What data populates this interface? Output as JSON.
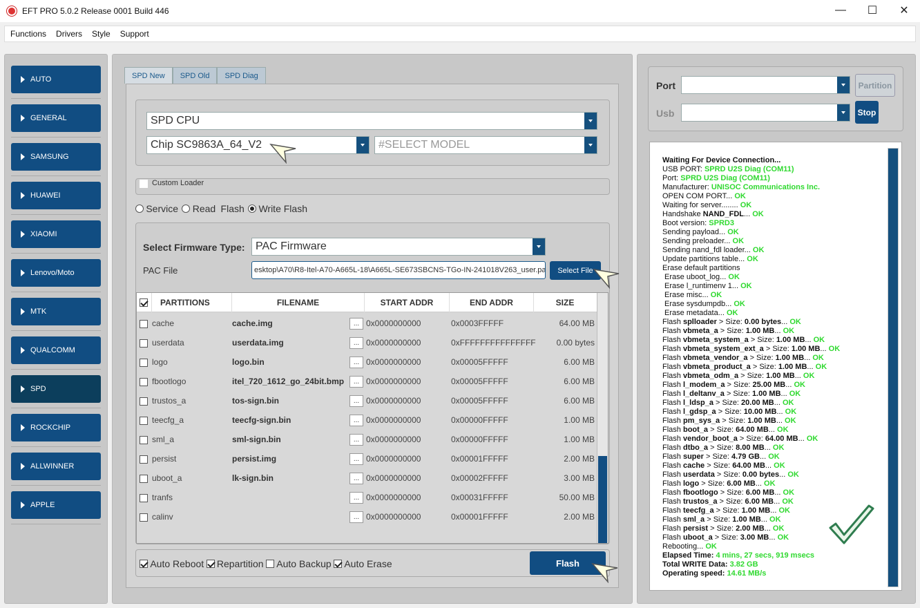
{
  "window": {
    "title": "EFT PRO 5.0.2 Release 0001 Build 446"
  },
  "menu": [
    "Functions",
    "Drivers",
    "Style",
    "Support"
  ],
  "sidebar": [
    {
      "label": "AUTO",
      "active": false
    },
    {
      "label": "GENERAL",
      "active": false
    },
    {
      "label": "SAMSUNG",
      "active": false
    },
    {
      "label": "HUAWEI",
      "active": false
    },
    {
      "label": "XIAOMI",
      "active": false
    },
    {
      "label": "Lenovo/Moto",
      "active": false
    },
    {
      "label": "MTK",
      "active": false
    },
    {
      "label": "QUALCOMM",
      "active": false
    },
    {
      "label": "SPD",
      "active": true
    },
    {
      "label": "ROCKCHIP",
      "active": false
    },
    {
      "label": "ALLWINNER",
      "active": false
    },
    {
      "label": "APPLE",
      "active": false
    }
  ],
  "tabs": [
    "SPD New",
    "SPD Old",
    "SPD Diag"
  ],
  "cpu_select": {
    "value": "SPD CPU"
  },
  "chip_select": {
    "value": "Chip SC9863A_64_V2"
  },
  "model_select": {
    "value": "#SELECT MODEL"
  },
  "custom_loader": {
    "label": "Custom Loader",
    "checked": false
  },
  "mode_options": {
    "service": "Service",
    "read": "Read",
    "flash": "Flash",
    "write_flash": "Write Flash",
    "selected": "write_flash"
  },
  "firmware": {
    "type_label": "Select Firmware Type:",
    "type_value": "PAC Firmware",
    "pac_label": "PAC File",
    "pac_value": "esktop\\A70\\R8-Itel-A70-A665L-18\\A665L-SE673SBCNS-TGo-IN-241018V263_user.pac",
    "select_button": "Select File"
  },
  "table": {
    "headers": [
      "PARTITIONS",
      "FILENAME",
      "START ADDR",
      "END ADDR",
      "SIZE"
    ],
    "dots": "...",
    "rows": [
      {
        "name": "cache",
        "file": "cache.img",
        "start": "0x0000000000",
        "end": "0x0003FFFFF",
        "size": "64.00 MB"
      },
      {
        "name": "userdata",
        "file": "userdata.img",
        "start": "0x0000000000",
        "end": "0xFFFFFFFFFFFFFFF",
        "size": "0.00 bytes"
      },
      {
        "name": "logo",
        "file": "logo.bin",
        "start": "0x0000000000",
        "end": "0x00005FFFFF",
        "size": "6.00 MB"
      },
      {
        "name": "fbootlogo",
        "file": "itel_720_1612_go_24bit.bmp",
        "start": "0x0000000000",
        "end": "0x00005FFFFF",
        "size": "6.00 MB"
      },
      {
        "name": "trustos_a",
        "file": "tos-sign.bin",
        "start": "0x0000000000",
        "end": "0x00005FFFFF",
        "size": "6.00 MB"
      },
      {
        "name": "teecfg_a",
        "file": "teecfg-sign.bin",
        "start": "0x0000000000",
        "end": "0x00000FFFFF",
        "size": "1.00 MB"
      },
      {
        "name": "sml_a",
        "file": "sml-sign.bin",
        "start": "0x0000000000",
        "end": "0x00000FFFFF",
        "size": "1.00 MB"
      },
      {
        "name": "persist",
        "file": "persist.img",
        "start": "0x0000000000",
        "end": "0x00001FFFFF",
        "size": "2.00 MB"
      },
      {
        "name": "uboot_a",
        "file": "lk-sign.bin",
        "start": "0x0000000000",
        "end": "0x00002FFFFF",
        "size": "3.00 MB"
      },
      {
        "name": "tranfs",
        "file": "",
        "start": "0x0000000000",
        "end": "0x00031FFFFF",
        "size": "50.00 MB"
      },
      {
        "name": "calinv",
        "file": "",
        "start": "0x0000000000",
        "end": "0x00001FFFFF",
        "size": "2.00 MB"
      }
    ]
  },
  "bottom_options": {
    "auto_reboot": "Auto Reboot",
    "repartition": "Repartition",
    "auto_backup": "Auto Backup",
    "auto_erase": "Auto Erase"
  },
  "flash_button": "Flash",
  "port": {
    "label": "Port",
    "usb_label": "Usb",
    "partition_button": "Partition",
    "stop_button": "Stop"
  },
  "log": [
    [
      [
        "b",
        "Waiting For Device Connection..."
      ]
    ],
    [
      [
        "t",
        "USB PORT: "
      ],
      [
        "g",
        "SPRD U2S Diag (COM11)"
      ]
    ],
    [
      [
        "t",
        "Port: "
      ],
      [
        "g",
        "SPRD U2S Diag (COM11)"
      ]
    ],
    [
      [
        "t",
        "Manufacturer: "
      ],
      [
        "g",
        "UNISOC Communications Inc."
      ]
    ],
    [
      [
        "t",
        "OPEN COM PORT... "
      ],
      [
        "g",
        "OK"
      ]
    ],
    [
      [
        "t",
        "Waiting for server........ "
      ],
      [
        "g",
        "OK"
      ]
    ],
    [
      [
        "t",
        "Handshake "
      ],
      [
        "b",
        "NAND_FDL"
      ],
      [
        "t",
        "... "
      ],
      [
        "g",
        "OK"
      ]
    ],
    [
      [
        "t",
        "Boot version: "
      ],
      [
        "g",
        "SPRD3"
      ]
    ],
    [
      [
        "t",
        "Sending payload... "
      ],
      [
        "g",
        "OK"
      ]
    ],
    [
      [
        "t",
        "Sending preloader... "
      ],
      [
        "g",
        "OK"
      ]
    ],
    [
      [
        "t",
        "Sending nand_fdl loader... "
      ],
      [
        "g",
        "OK"
      ]
    ],
    [
      [
        "t",
        "Update partitions table... "
      ],
      [
        "g",
        "OK"
      ]
    ],
    [
      [
        "t",
        "Erase default partitions"
      ]
    ],
    [
      [
        "t",
        " Erase uboot_log... "
      ],
      [
        "g",
        "OK"
      ]
    ],
    [
      [
        "t",
        " Erase l_runtimenv 1... "
      ],
      [
        "g",
        "OK"
      ]
    ],
    [
      [
        "t",
        " Erase misc... "
      ],
      [
        "g",
        "OK"
      ]
    ],
    [
      [
        "t",
        " Erase sysdumpdb... "
      ],
      [
        "g",
        "OK"
      ]
    ],
    [
      [
        "t",
        " Erase metadata... "
      ],
      [
        "g",
        "OK"
      ]
    ],
    [
      [
        "t",
        "Flash "
      ],
      [
        "b",
        "splloader"
      ],
      [
        "t",
        " > Size: "
      ],
      [
        "b",
        "0.00 bytes"
      ],
      [
        "t",
        "... "
      ],
      [
        "g",
        "OK"
      ]
    ],
    [
      [
        "t",
        "Flash "
      ],
      [
        "b",
        "vbmeta_a"
      ],
      [
        "t",
        " > Size: "
      ],
      [
        "b",
        "1.00 MB"
      ],
      [
        "t",
        "... "
      ],
      [
        "g",
        "OK"
      ]
    ],
    [
      [
        "t",
        "Flash "
      ],
      [
        "b",
        "vbmeta_system_a"
      ],
      [
        "t",
        " > Size: "
      ],
      [
        "b",
        "1.00 MB"
      ],
      [
        "t",
        "... "
      ],
      [
        "g",
        "OK"
      ]
    ],
    [
      [
        "t",
        "Flash "
      ],
      [
        "b",
        "vbmeta_system_ext_a"
      ],
      [
        "t",
        " > Size: "
      ],
      [
        "b",
        "1.00 MB"
      ],
      [
        "t",
        "... "
      ],
      [
        "g",
        "OK"
      ]
    ],
    [
      [
        "t",
        "Flash "
      ],
      [
        "b",
        "vbmeta_vendor_a"
      ],
      [
        "t",
        " > Size: "
      ],
      [
        "b",
        "1.00 MB"
      ],
      [
        "t",
        "... "
      ],
      [
        "g",
        "OK"
      ]
    ],
    [
      [
        "t",
        "Flash "
      ],
      [
        "b",
        "vbmeta_product_a"
      ],
      [
        "t",
        " > Size: "
      ],
      [
        "b",
        "1.00 MB"
      ],
      [
        "t",
        "... "
      ],
      [
        "g",
        "OK"
      ]
    ],
    [
      [
        "t",
        "Flash "
      ],
      [
        "b",
        "vbmeta_odm_a"
      ],
      [
        "t",
        " > Size: "
      ],
      [
        "b",
        "1.00 MB"
      ],
      [
        "t",
        "... "
      ],
      [
        "g",
        "OK"
      ]
    ],
    [
      [
        "t",
        "Flash "
      ],
      [
        "b",
        "l_modem_a"
      ],
      [
        "t",
        " > Size: "
      ],
      [
        "b",
        "25.00 MB"
      ],
      [
        "t",
        "... "
      ],
      [
        "g",
        "OK"
      ]
    ],
    [
      [
        "t",
        "Flash "
      ],
      [
        "b",
        "l_deltanv_a"
      ],
      [
        "t",
        " > Size: "
      ],
      [
        "b",
        "1.00 MB"
      ],
      [
        "t",
        "... "
      ],
      [
        "g",
        "OK"
      ]
    ],
    [
      [
        "t",
        "Flash "
      ],
      [
        "b",
        "l_ldsp_a"
      ],
      [
        "t",
        " > Size: "
      ],
      [
        "b",
        "20.00 MB"
      ],
      [
        "t",
        "... "
      ],
      [
        "g",
        "OK"
      ]
    ],
    [
      [
        "t",
        "Flash "
      ],
      [
        "b",
        "l_gdsp_a"
      ],
      [
        "t",
        " > Size: "
      ],
      [
        "b",
        "10.00 MB"
      ],
      [
        "t",
        "... "
      ],
      [
        "g",
        "OK"
      ]
    ],
    [
      [
        "t",
        "Flash "
      ],
      [
        "b",
        "pm_sys_a"
      ],
      [
        "t",
        " > Size: "
      ],
      [
        "b",
        "1.00 MB"
      ],
      [
        "t",
        "... "
      ],
      [
        "g",
        "OK"
      ]
    ],
    [
      [
        "t",
        "Flash "
      ],
      [
        "b",
        "boot_a"
      ],
      [
        "t",
        " > Size: "
      ],
      [
        "b",
        "64.00 MB"
      ],
      [
        "t",
        "... "
      ],
      [
        "g",
        "OK"
      ]
    ],
    [
      [
        "t",
        "Flash "
      ],
      [
        "b",
        "vendor_boot_a"
      ],
      [
        "t",
        " > Size: "
      ],
      [
        "b",
        "64.00 MB"
      ],
      [
        "t",
        "... "
      ],
      [
        "g",
        "OK"
      ]
    ],
    [
      [
        "t",
        "Flash "
      ],
      [
        "b",
        "dtbo_a"
      ],
      [
        "t",
        " > Size: "
      ],
      [
        "b",
        "8.00 MB"
      ],
      [
        "t",
        "... "
      ],
      [
        "g",
        "OK"
      ]
    ],
    [
      [
        "t",
        "Flash "
      ],
      [
        "b",
        "super"
      ],
      [
        "t",
        " > Size: "
      ],
      [
        "b",
        "4.79 GB"
      ],
      [
        "t",
        "... "
      ],
      [
        "g",
        "OK"
      ]
    ],
    [
      [
        "t",
        "Flash "
      ],
      [
        "b",
        "cache"
      ],
      [
        "t",
        " > Size: "
      ],
      [
        "b",
        "64.00 MB"
      ],
      [
        "t",
        "... "
      ],
      [
        "g",
        "OK"
      ]
    ],
    [
      [
        "t",
        "Flash "
      ],
      [
        "b",
        "userdata"
      ],
      [
        "t",
        " > Size: "
      ],
      [
        "b",
        "0.00 bytes"
      ],
      [
        "t",
        "... "
      ],
      [
        "g",
        "OK"
      ]
    ],
    [
      [
        "t",
        "Flash "
      ],
      [
        "b",
        "logo"
      ],
      [
        "t",
        " > Size: "
      ],
      [
        "b",
        "6.00 MB"
      ],
      [
        "t",
        "... "
      ],
      [
        "g",
        "OK"
      ]
    ],
    [
      [
        "t",
        "Flash "
      ],
      [
        "b",
        "fbootlogo"
      ],
      [
        "t",
        " > Size: "
      ],
      [
        "b",
        "6.00 MB"
      ],
      [
        "t",
        "... "
      ],
      [
        "g",
        "OK"
      ]
    ],
    [
      [
        "t",
        "Flash "
      ],
      [
        "b",
        "trustos_a"
      ],
      [
        "t",
        " > Size: "
      ],
      [
        "b",
        "6.00 MB"
      ],
      [
        "t",
        "... "
      ],
      [
        "g",
        "OK"
      ]
    ],
    [
      [
        "t",
        "Flash "
      ],
      [
        "b",
        "teecfg_a"
      ],
      [
        "t",
        " > Size: "
      ],
      [
        "b",
        "1.00 MB"
      ],
      [
        "t",
        "... "
      ],
      [
        "g",
        "OK"
      ]
    ],
    [
      [
        "t",
        "Flash "
      ],
      [
        "b",
        "sml_a"
      ],
      [
        "t",
        " > Size: "
      ],
      [
        "b",
        "1.00 MB"
      ],
      [
        "t",
        "... "
      ],
      [
        "g",
        "OK"
      ]
    ],
    [
      [
        "t",
        "Flash "
      ],
      [
        "b",
        "persist"
      ],
      [
        "t",
        " > Size: "
      ],
      [
        "b",
        "2.00 MB"
      ],
      [
        "t",
        "... "
      ],
      [
        "g",
        "OK"
      ]
    ],
    [
      [
        "t",
        "Flash "
      ],
      [
        "b",
        "uboot_a"
      ],
      [
        "t",
        " > Size: "
      ],
      [
        "b",
        "3.00 MB"
      ],
      [
        "t",
        "... "
      ],
      [
        "g",
        "OK"
      ]
    ],
    [
      [
        "t",
        "Rebooting... "
      ],
      [
        "g",
        "OK"
      ]
    ],
    [
      [
        "b",
        "Elapsed Time: "
      ],
      [
        "g",
        "4 mins, 27 secs, 919 msecs"
      ]
    ],
    [
      [
        "b",
        "Total WRITE Data: "
      ],
      [
        "g",
        "3.82 GB"
      ]
    ],
    [
      [
        "b",
        "Operating speed: "
      ],
      [
        "g",
        "14.61 MB/s"
      ]
    ]
  ],
  "icons": {
    "app": "app-logo-icon",
    "check": "success-checkmark-icon",
    "pointer": "pointer-arrow-icon"
  },
  "colors": {
    "accent": "#114d82",
    "ok": "#2fd92f",
    "panel": "#c8c8c8"
  }
}
